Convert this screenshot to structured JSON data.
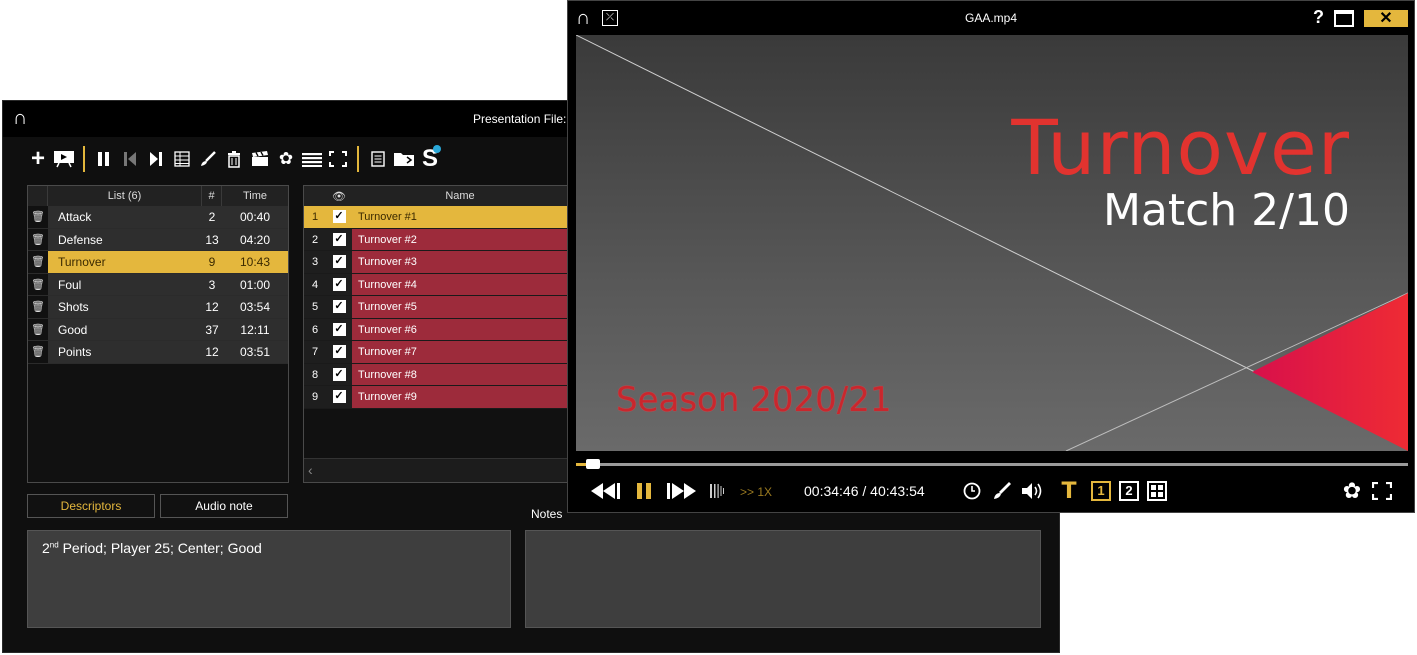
{
  "presentation": {
    "title": "Presentation File:",
    "toolbar": [
      "add-icon",
      "present-icon",
      "pause-icon",
      "prev-icon",
      "next-icon",
      "table-icon",
      "brush-icon",
      "trash-icon",
      "clapper-icon",
      "gear-icon",
      "list-icon",
      "fullscreen-icon",
      "doc-icon",
      "folder-icon",
      "s-logo-icon"
    ],
    "list": {
      "header_name": "List (6)",
      "header_num": "#",
      "header_time": "Time",
      "rows": [
        {
          "name": "Attack",
          "num": "2",
          "time": "00:40"
        },
        {
          "name": "Defense",
          "num": "13",
          "time": "04:20"
        },
        {
          "name": "Turnover",
          "num": "9",
          "time": "10:43"
        },
        {
          "name": "Foul",
          "num": "3",
          "time": "01:00"
        },
        {
          "name": "Shots",
          "num": "12",
          "time": "03:54"
        },
        {
          "name": "Good",
          "num": "37",
          "time": "12:11"
        },
        {
          "name": "Points",
          "num": "12",
          "time": "03:51"
        }
      ]
    },
    "clips": {
      "header_name": "Name",
      "rows": [
        {
          "idx": "1",
          "name": "Turnover #1"
        },
        {
          "idx": "2",
          "name": "Turnover #2"
        },
        {
          "idx": "3",
          "name": "Turnover #3"
        },
        {
          "idx": "4",
          "name": "Turnover #4"
        },
        {
          "idx": "5",
          "name": "Turnover #5"
        },
        {
          "idx": "6",
          "name": "Turnover #6"
        },
        {
          "idx": "7",
          "name": "Turnover #7"
        },
        {
          "idx": "8",
          "name": "Turnover #8"
        },
        {
          "idx": "9",
          "name": "Turnover #9"
        }
      ]
    },
    "tabs": {
      "descriptors": "Descriptors",
      "audio": "Audio note"
    },
    "notes_label": "Notes",
    "description": {
      "ordinal": "2",
      "sup": "nd",
      "text": " Period; Player 25; Center; Good"
    }
  },
  "player": {
    "file": "GAA.mp4",
    "help": "?",
    "close": "✕",
    "video": {
      "title": "Turnover",
      "subtitle": "Match 2/10",
      "season": "Season 2020/21"
    },
    "progress": 0.012,
    "speed": ">> 1X",
    "timecode": "00:34:46 / 40:43:54",
    "view1": "1",
    "view2": "2"
  }
}
